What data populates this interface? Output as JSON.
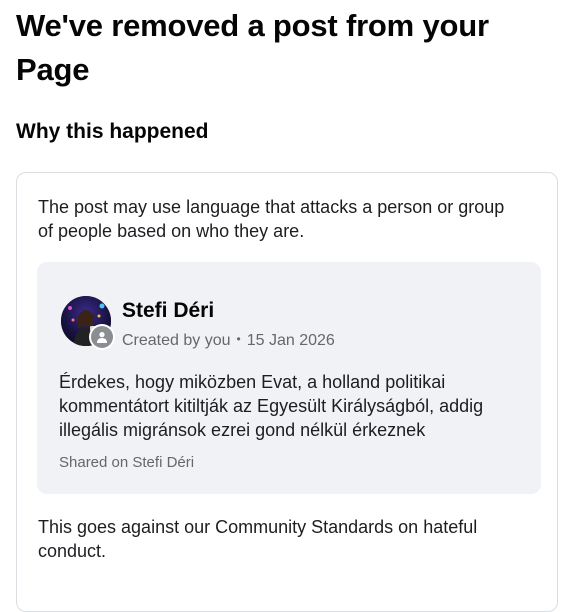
{
  "page": {
    "title": "We've removed a post from your Page",
    "section_heading": "Why this happened"
  },
  "reason": {
    "text": "The post may use language that attacks a person or group of people based on who they are.",
    "standards_text": "This goes against our Community Standards on hateful conduct."
  },
  "post": {
    "author_name": "Stefi Déri",
    "created_by": "Created by you",
    "separator": "•",
    "date": "15 Jan 2026",
    "body": "Érdekes, hogy miközben Evat, a holland politikai kommentátort kitiltják az Egyesült Királyságból, addig illegális migránsok ezrei gond nélkül érkeznek",
    "shared_on": "Shared on Stefi Déri",
    "avatar_icon": "profile-photo",
    "badge_icon": "person-icon"
  },
  "colors": {
    "card_border": "#dadde1",
    "preview_background": "#f0f2f5",
    "secondary_text": "#65676b",
    "primary_text": "#1c1e21"
  }
}
